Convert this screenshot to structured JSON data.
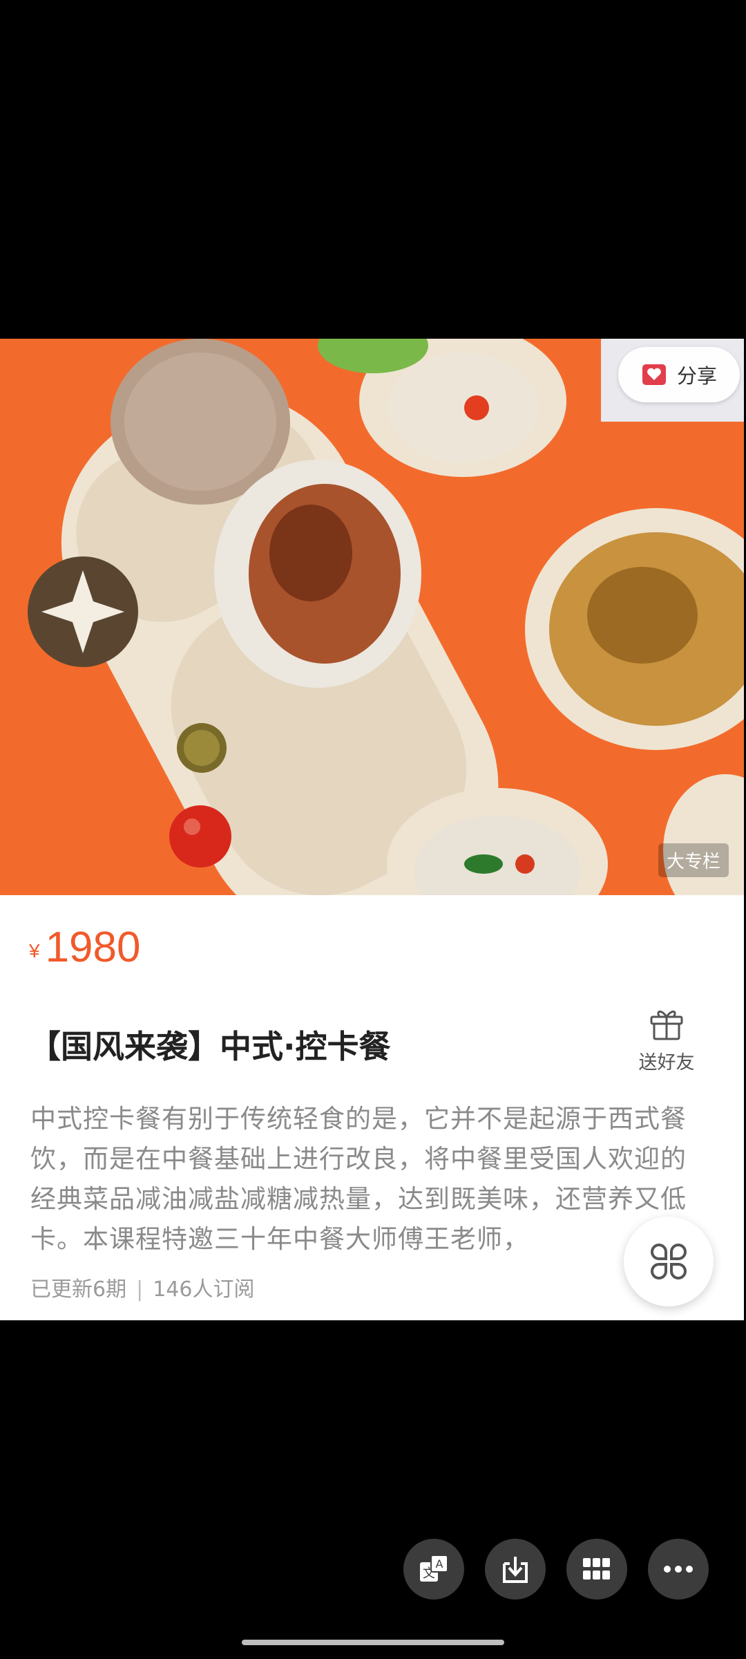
{
  "hero": {
    "share_label": "分享",
    "watermark": "大专栏"
  },
  "product": {
    "currency": "¥",
    "price": "1980",
    "title": "【国风来袭】中式·控卡餐",
    "gift_label": "送好友",
    "description": "中式控卡餐有别于传统轻食的是，它并不是起源于西式餐饮，而是在中餐基础上进行改良，将中餐里受国人欢迎的经典菜品减油减盐减糖减热量，达到既美味，还营养又低卡。本课程特邀三十年中餐大师傅王老师，",
    "updates": "已更新6期",
    "subscribers": "146人订阅"
  },
  "colors": {
    "accent": "#f05a2a",
    "hero_bg": "#f36b2c"
  },
  "icons": [
    "share-heart-icon",
    "gift-icon",
    "floating-menu-icon",
    "translate-icon",
    "download-icon",
    "grid-icon",
    "more-icon"
  ]
}
